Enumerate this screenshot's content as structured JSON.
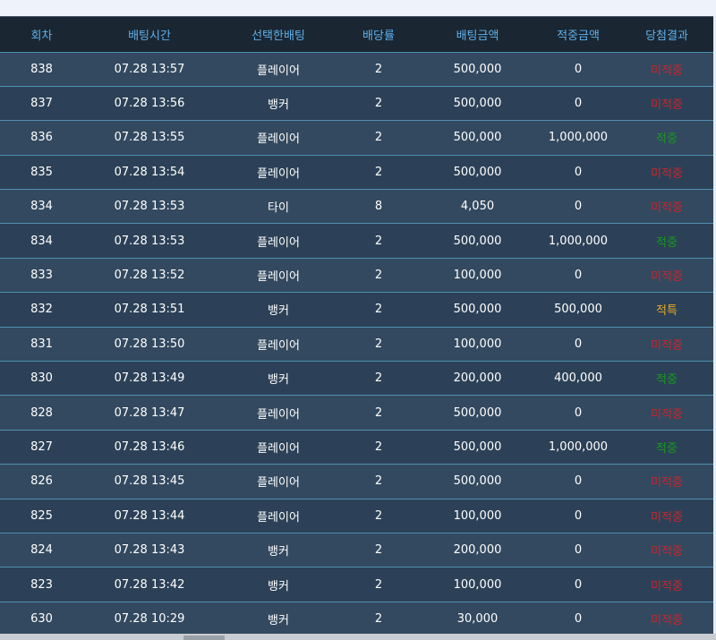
{
  "table": {
    "columns": [
      "회차",
      "배팅시간",
      "선택한배팅",
      "배당률",
      "배팅금액",
      "적중금액",
      "당첨결과"
    ],
    "rows": [
      {
        "round": "838",
        "time": "07.28 13:57",
        "pick": "플레이어",
        "odds": "2",
        "bet": "500,000",
        "win": "0",
        "result": "미적중",
        "status": "lose"
      },
      {
        "round": "837",
        "time": "07.28 13:56",
        "pick": "뱅커",
        "odds": "2",
        "bet": "500,000",
        "win": "0",
        "result": "미적중",
        "status": "lose"
      },
      {
        "round": "836",
        "time": "07.28 13:55",
        "pick": "플레이어",
        "odds": "2",
        "bet": "500,000",
        "win": "1,000,000",
        "result": "적중",
        "status": "win"
      },
      {
        "round": "835",
        "time": "07.28 13:54",
        "pick": "플레이어",
        "odds": "2",
        "bet": "500,000",
        "win": "0",
        "result": "미적중",
        "status": "lose"
      },
      {
        "round": "834",
        "time": "07.28 13:53",
        "pick": "타이",
        "odds": "8",
        "bet": "4,050",
        "win": "0",
        "result": "미적중",
        "status": "lose"
      },
      {
        "round": "834",
        "time": "07.28 13:53",
        "pick": "플레이어",
        "odds": "2",
        "bet": "500,000",
        "win": "1,000,000",
        "result": "적중",
        "status": "win"
      },
      {
        "round": "833",
        "time": "07.28 13:52",
        "pick": "플레이어",
        "odds": "2",
        "bet": "100,000",
        "win": "0",
        "result": "미적중",
        "status": "lose"
      },
      {
        "round": "832",
        "time": "07.28 13:51",
        "pick": "뱅커",
        "odds": "2",
        "bet": "500,000",
        "win": "500,000",
        "result": "적특",
        "status": "tie"
      },
      {
        "round": "831",
        "time": "07.28 13:50",
        "pick": "플레이어",
        "odds": "2",
        "bet": "100,000",
        "win": "0",
        "result": "미적중",
        "status": "lose"
      },
      {
        "round": "830",
        "time": "07.28 13:49",
        "pick": "뱅커",
        "odds": "2",
        "bet": "200,000",
        "win": "400,000",
        "result": "적중",
        "status": "win"
      },
      {
        "round": "828",
        "time": "07.28 13:47",
        "pick": "플레이어",
        "odds": "2",
        "bet": "500,000",
        "win": "0",
        "result": "미적중",
        "status": "lose"
      },
      {
        "round": "827",
        "time": "07.28 13:46",
        "pick": "플레이어",
        "odds": "2",
        "bet": "500,000",
        "win": "1,000,000",
        "result": "적중",
        "status": "win"
      },
      {
        "round": "826",
        "time": "07.28 13:45",
        "pick": "플레이어",
        "odds": "2",
        "bet": "500,000",
        "win": "0",
        "result": "미적중",
        "status": "lose"
      },
      {
        "round": "825",
        "time": "07.28 13:44",
        "pick": "플레이어",
        "odds": "2",
        "bet": "100,000",
        "win": "0",
        "result": "미적중",
        "status": "lose"
      },
      {
        "round": "824",
        "time": "07.28 13:43",
        "pick": "뱅커",
        "odds": "2",
        "bet": "200,000",
        "win": "0",
        "result": "미적중",
        "status": "lose"
      },
      {
        "round": "823",
        "time": "07.28 13:42",
        "pick": "뱅커",
        "odds": "2",
        "bet": "100,000",
        "win": "0",
        "result": "미적중",
        "status": "lose"
      },
      {
        "round": "630",
        "time": "07.28 10:29",
        "pick": "뱅커",
        "odds": "2",
        "bet": "30,000",
        "win": "0",
        "result": "미적중",
        "status": "lose"
      }
    ]
  },
  "colors": {
    "header_text": "#5fb0ec",
    "lose": "#c8252e",
    "win": "#169a1c",
    "tie": "#e6a623"
  }
}
